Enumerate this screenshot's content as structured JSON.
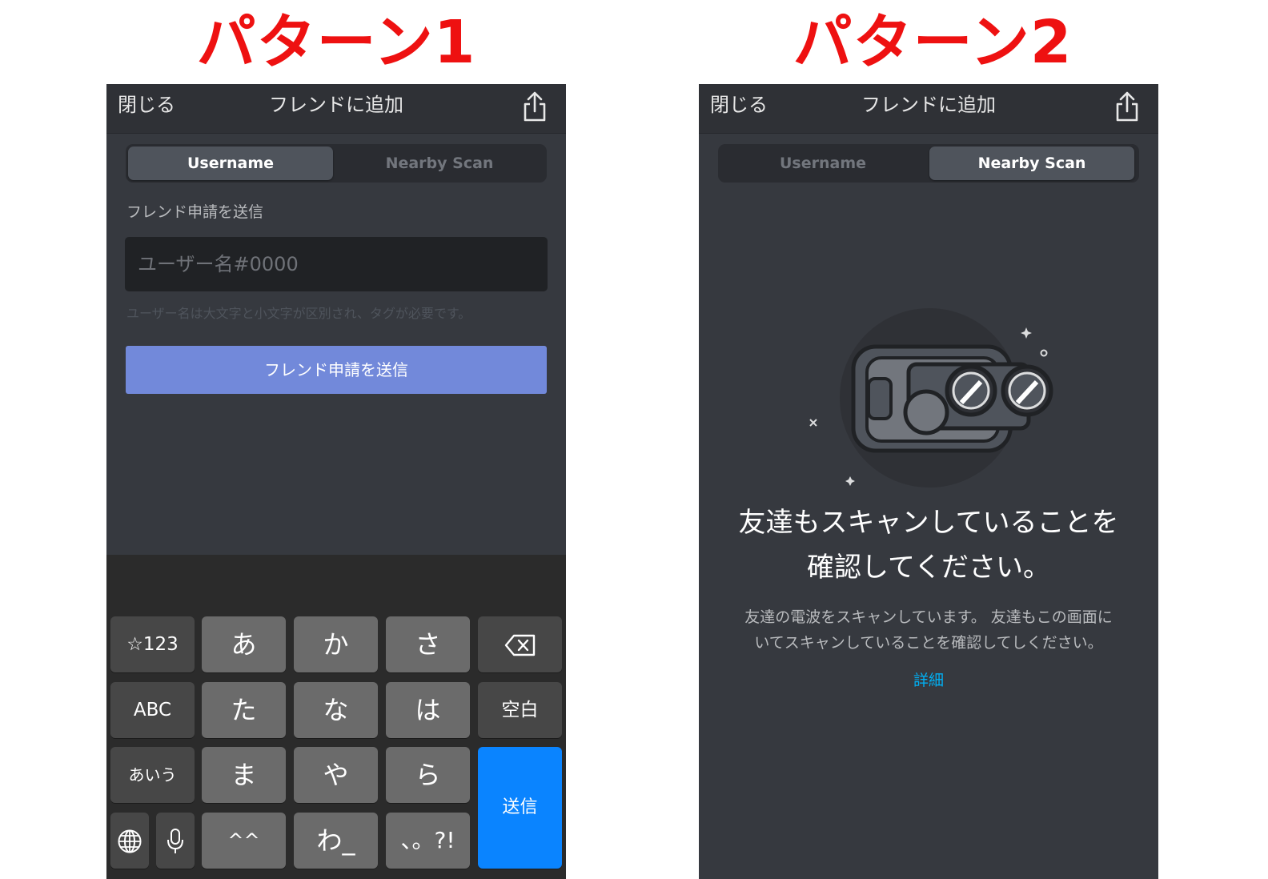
{
  "patterns": [
    {
      "title": "パターン1",
      "topbar": {
        "close_label": "閉じる",
        "title": "フレンドに追加",
        "share_icon": "share-icon"
      },
      "segments": [
        {
          "label": "Username",
          "active": true
        },
        {
          "label": "Nearby Scan",
          "active": false
        }
      ],
      "section_label": "フレンド申請を送信",
      "username_input": {
        "value": "",
        "placeholder": "ユーザー名#0000"
      },
      "hint": "ユーザー名は大文字と小文字が区別され、タグが必要です。",
      "send_button": "フレンド申請を送信",
      "keyboard": {
        "keys": [
          [
            "☆123",
            "あ",
            "か",
            "さ",
            "delete-icon"
          ],
          [
            "ABC",
            "た",
            "な",
            "は",
            "空白"
          ],
          [
            "あいう",
            "ま",
            "や",
            "ら",
            "送信"
          ],
          [
            "globe-icon",
            "microphone-icon",
            "^^",
            "わ_",
            "、。?!"
          ]
        ]
      }
    },
    {
      "title": "パターン2",
      "topbar": {
        "close_label": "閉じる",
        "title": "フレンドに追加",
        "share_icon": "share-icon"
      },
      "segments": [
        {
          "label": "Username",
          "active": false
        },
        {
          "label": "Nearby Scan",
          "active": true
        }
      ],
      "illustration": "binoculars-icon",
      "heading_line1": "友達もスキャンしていることを",
      "heading_line2": "確認してください。",
      "description_line1": "友達の電波をスキャンしています。 友達もこの画面に",
      "description_line2": "いてスキャンしていることを確認してしください。",
      "detail_link": "詳細"
    }
  ],
  "colors": {
    "title_red": "#ee1111",
    "background": "#36393f",
    "blurple": "#7289da",
    "link_blue": "#00b0f4",
    "keyboard_blue": "#0a84ff"
  }
}
